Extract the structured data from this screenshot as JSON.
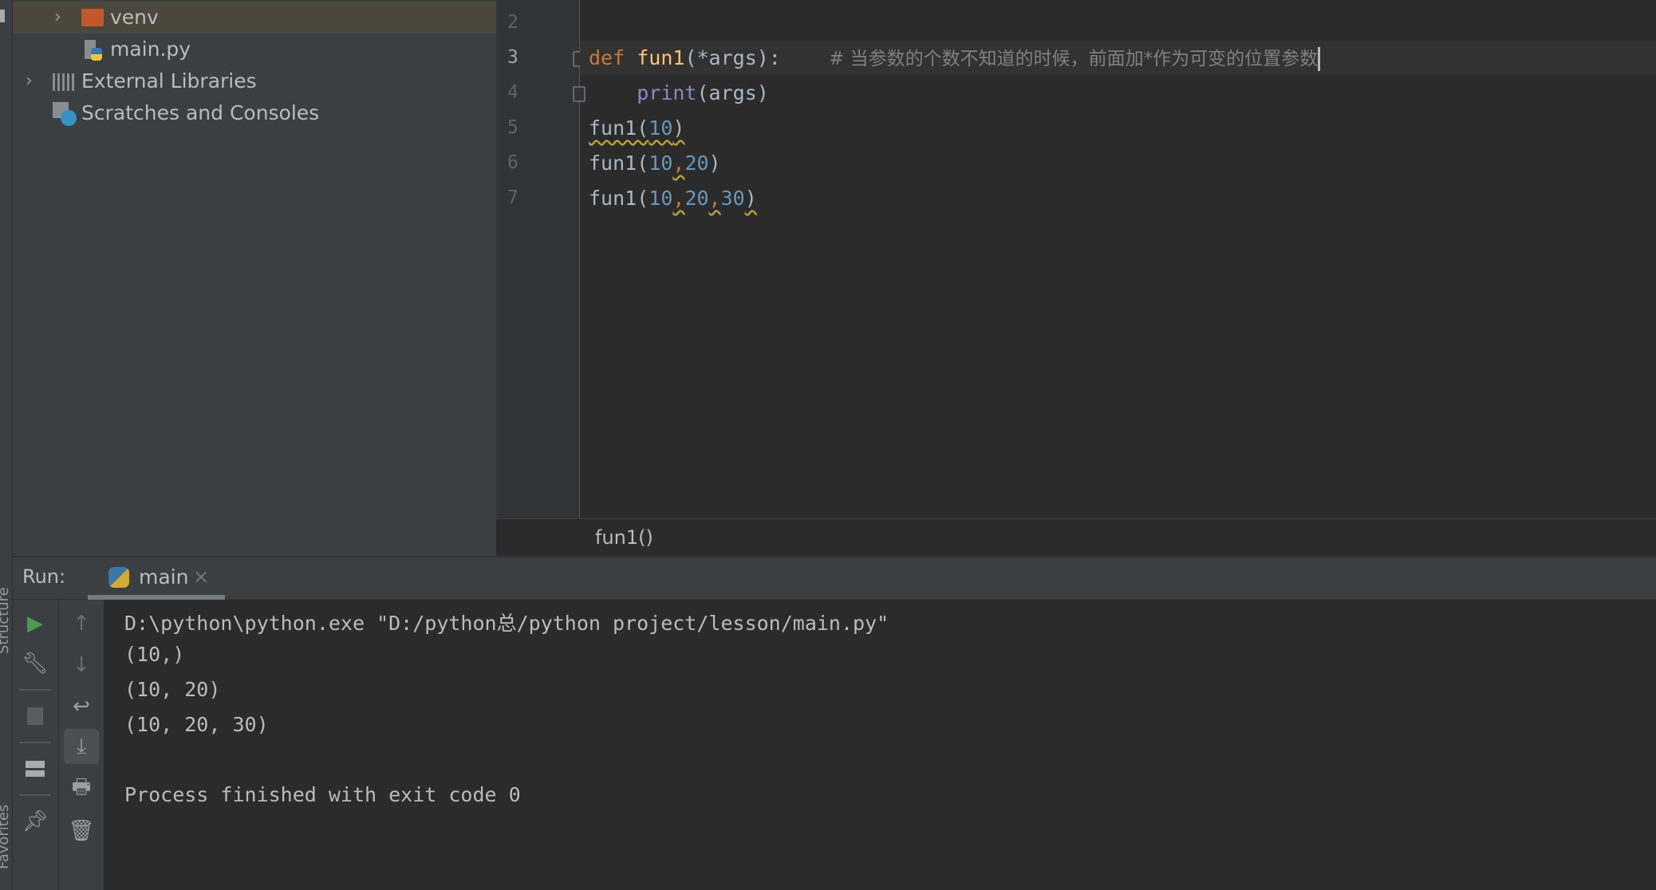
{
  "project_tree": {
    "items": [
      {
        "label": "venv",
        "icon": "folder-icon",
        "expandable": true,
        "selected": true
      },
      {
        "label": "main.py",
        "icon": "python-file-icon"
      },
      {
        "label": "External Libraries",
        "icon": "libraries-icon",
        "expandable": true
      },
      {
        "label": "Scratches and Consoles",
        "icon": "scratches-icon"
      }
    ]
  },
  "editor": {
    "line_numbers": [
      "2",
      "3",
      "4",
      "5",
      "6",
      "7"
    ],
    "current_line": "3",
    "lines": {
      "l3": {
        "kw": "def",
        "fn": "fun1",
        "rest": "(*args):",
        "comment": "# 当参数的个数不知道的时候，前面加*作为可变的位置参数"
      },
      "l4": {
        "indent": "    ",
        "bi": "print",
        "rest": "(args)"
      },
      "l5": {
        "a": "fun1(",
        "n1": "10",
        "b": ")"
      },
      "l6": {
        "a": "fun1(",
        "n1": "10",
        "c1": ",",
        "n2": "20",
        "b": ")"
      },
      "l7": {
        "a": "fun1(",
        "n1": "10",
        "c1": ",",
        "n2": "20",
        "c2": ",",
        "n3": "30",
        "b": ")"
      }
    },
    "breadcrumb": "fun1()"
  },
  "run": {
    "label": "Run:",
    "tab": "main",
    "close": "×",
    "output": [
      "D:\\python\\python.exe \"D:/python总/python project/lesson/main.py\"",
      "(10,)",
      "(10, 20)",
      "(10, 20, 30)",
      "",
      "Process finished with exit code 0"
    ]
  },
  "side_tabs": {
    "structure": "Structure",
    "favorites": "Favorites"
  },
  "colors": {
    "keyword": "#cc7832",
    "function": "#ffc66d",
    "number": "#6897bb",
    "builtin": "#8888c6",
    "comment": "#808080",
    "run_green": "#499c54"
  }
}
